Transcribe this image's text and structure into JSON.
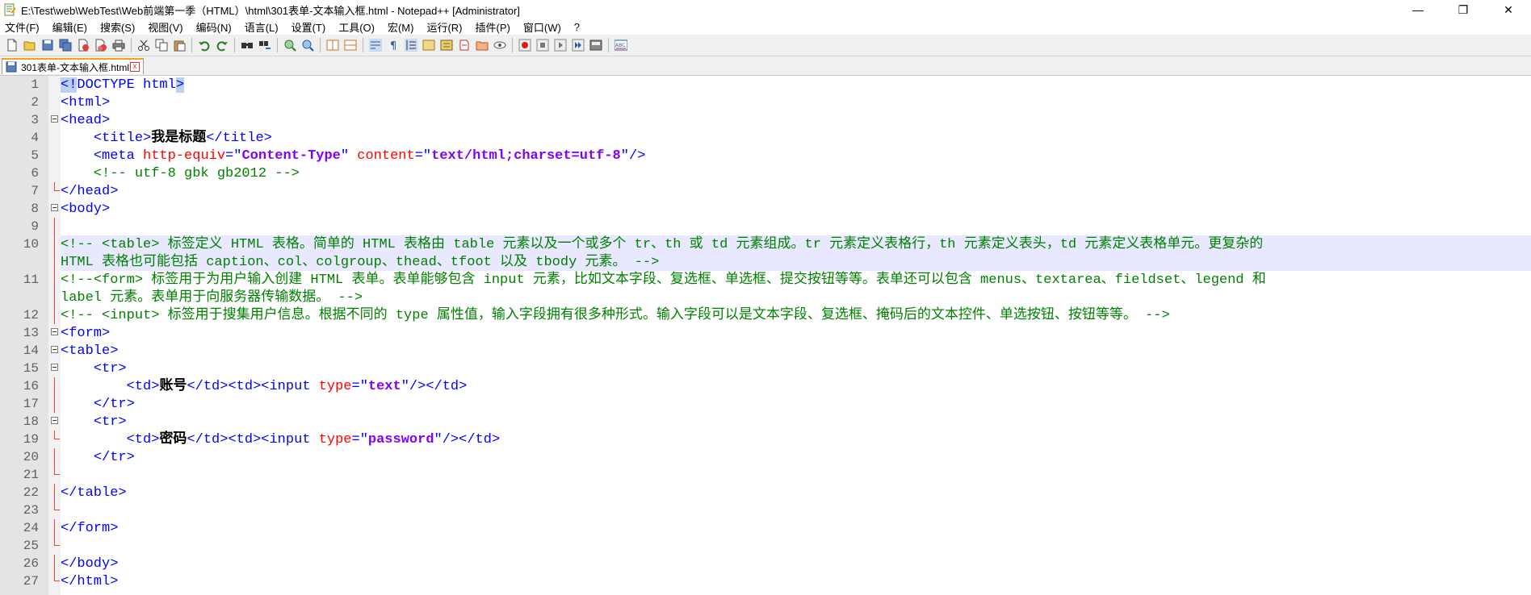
{
  "window": {
    "title": "E:\\Test\\web\\WebTest\\Web前端第一季（HTML）\\html\\301表单-文本输入框.html - Notepad++ [Administrator]",
    "min": "—",
    "restore": "❐",
    "close": "✕"
  },
  "menu": [
    "文件(F)",
    "编辑(E)",
    "搜索(S)",
    "视图(V)",
    "编码(N)",
    "语言(L)",
    "设置(T)",
    "工具(O)",
    "宏(M)",
    "运行(R)",
    "插件(P)",
    "窗口(W)",
    "?"
  ],
  "tab": {
    "label": "301表单-文本输入框.html",
    "close": "x"
  },
  "lines": [
    {
      "n": "1",
      "t": "<!DOCTYPE html>"
    },
    {
      "n": "2",
      "t": "<html>"
    },
    {
      "n": "3",
      "t": "<head>"
    },
    {
      "n": "4",
      "t": "    <title>我是标题</title>"
    },
    {
      "n": "5",
      "t": "    <meta http-equiv=\"Content-Type\" content=\"text/html;charset=utf-8\"/>"
    },
    {
      "n": "6",
      "t": "    <!-- utf-8 gbk gb2012 -->"
    },
    {
      "n": "7",
      "t": "</head>"
    },
    {
      "n": "8",
      "t": "<body>"
    },
    {
      "n": "9",
      "t": ""
    },
    {
      "n": "10",
      "t": "<!-- <table> 标签定义 HTML 表格。简单的 HTML 表格由 table 元素以及一个或多个 tr、th 或 td 元素组成。tr 元素定义表格行，th 元素定义表头，td 元素定义表格单元。更复杂的"
    },
    {
      "n": "",
      "t": "HTML 表格也可能包括 caption、col、colgroup、thead、tfoot 以及 tbody 元素。 -->"
    },
    {
      "n": "11",
      "t": "<!--<form> 标签用于为用户输入创建 HTML 表单。表单能够包含 input 元素，比如文本字段、复选框、单选框、提交按钮等等。表单还可以包含 menus、textarea、fieldset、legend 和"
    },
    {
      "n": "",
      "t": "label 元素。表单用于向服务器传输数据。 -->"
    },
    {
      "n": "12",
      "t": "<!-- <input> 标签用于搜集用户信息。根据不同的 type 属性值，输入字段拥有很多种形式。输入字段可以是文本字段、复选框、掩码后的文本控件、单选按钮、按钮等等。 -->"
    },
    {
      "n": "13",
      "t": "<form>"
    },
    {
      "n": "14",
      "t": "<table>"
    },
    {
      "n": "15",
      "t": "    <tr>"
    },
    {
      "n": "16",
      "t": "        <td>账号</td><td><input type=\"text\"/></td>"
    },
    {
      "n": "17",
      "t": "    </tr>"
    },
    {
      "n": "18",
      "t": "    <tr>"
    },
    {
      "n": "19",
      "t": "        <td>密码</td><td><input type=\"password\"/></td>"
    },
    {
      "n": "20",
      "t": "    </tr>"
    },
    {
      "n": "21",
      "t": ""
    },
    {
      "n": "22",
      "t": "</table>"
    },
    {
      "n": "23",
      "t": ""
    },
    {
      "n": "24",
      "t": "</form>"
    },
    {
      "n": "25",
      "t": ""
    },
    {
      "n": "26",
      "t": "</body>"
    },
    {
      "n": "27",
      "t": "</html>"
    }
  ],
  "colors": {
    "tag": "#0000ff",
    "attr": "#ff0000",
    "value": "#8000ff",
    "comment": "#008000",
    "gutter": "#e4e4e4"
  },
  "icons": [
    "new-file-icon",
    "open-file-icon",
    "save-icon",
    "save-all-icon",
    "close-icon",
    "close-all-icon",
    "print-icon",
    "cut-icon",
    "copy-icon",
    "paste-icon",
    "undo-icon",
    "redo-icon",
    "find-icon",
    "replace-icon",
    "zoom-in-icon",
    "zoom-out-icon",
    "sync-v-icon",
    "sync-h-icon",
    "word-wrap-icon",
    "all-chars-icon",
    "indent-guide-icon",
    "doc-map-icon",
    "function-list-icon",
    "folder-workspace-icon",
    "monitor-icon",
    "record-macro-icon",
    "stop-macro-icon",
    "play-macro-icon",
    "run-macro-icon",
    "save-macro-icon",
    "spellcheck-icon"
  ]
}
